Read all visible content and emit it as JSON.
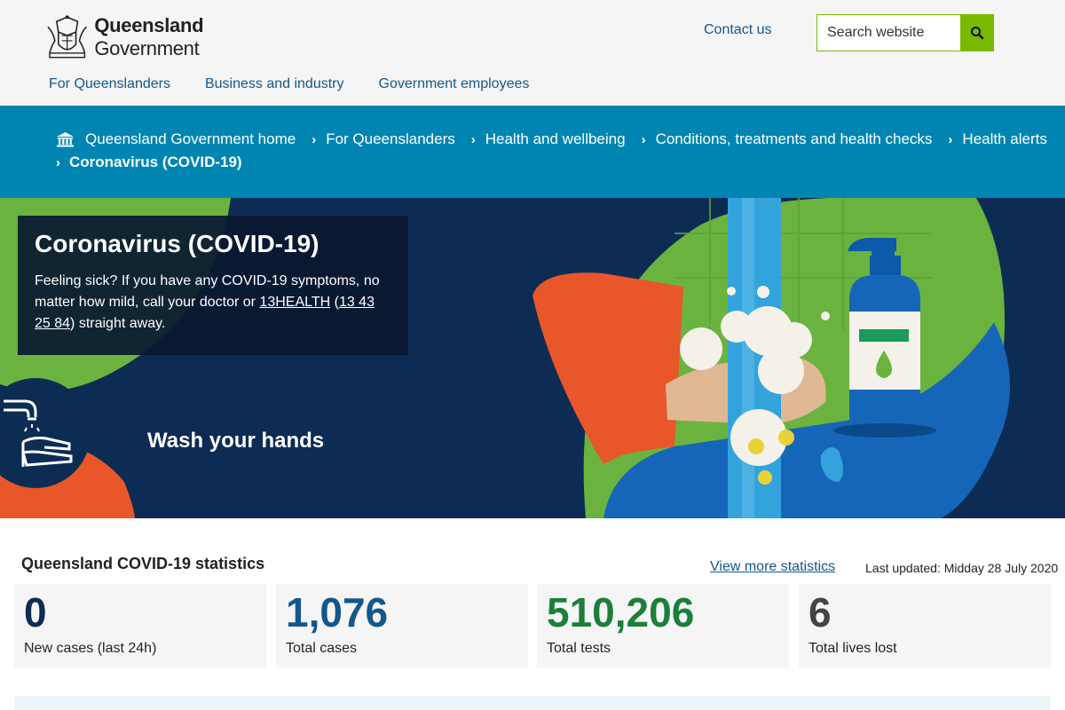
{
  "header": {
    "logo_bold": "Queensland",
    "logo_light": "Government",
    "contact_label": "Contact us",
    "search_placeholder": "Search website",
    "nav": [
      {
        "label": "For Queenslanders"
      },
      {
        "label": "Business and industry"
      },
      {
        "label": "Government employees"
      }
    ]
  },
  "breadcrumb": {
    "items": [
      {
        "label": "Queensland Government home"
      },
      {
        "label": "For Queenslanders"
      },
      {
        "label": "Health and wellbeing"
      },
      {
        "label": "Conditions, treatments and health checks"
      },
      {
        "label": "Health alerts"
      }
    ],
    "current": "Coronavirus (COVID-19)"
  },
  "hero": {
    "title": "Coronavirus (COVID-19)",
    "text_before": "Feeling sick? If you have any COVID-19 symptoms, no matter how mild, call your doctor or ",
    "link_health": "13HEALTH",
    "text_paren_open": " (",
    "link_phone": "13 43 25 84",
    "text_after": ") straight away.",
    "caption": "Wash your hands"
  },
  "stats": {
    "title": "Queensland COVID-19 statistics",
    "more_label": "View more statistics",
    "updated": "Last updated: Midday 28 July 2020",
    "cards": [
      {
        "value": "0",
        "label": "New cases (last 24h)",
        "color": "#0d2c54"
      },
      {
        "value": "1,076",
        "label": "Total cases",
        "color": "#13578b"
      },
      {
        "value": "510,206",
        "label": "Total tests",
        "color": "#1b7f3a"
      },
      {
        "value": "6",
        "label": "Total lives lost",
        "color": "#444444"
      }
    ]
  },
  "colors": {
    "header_bg": "#f5f5f5",
    "link": "#13578b",
    "breadcrumb_bg": "#0085b3",
    "banner_bg": "#0d2c54",
    "accent_green": "#78ba00",
    "orange": "#e8562a"
  },
  "icons": {
    "search": "search-icon",
    "home": "bank-building-icon",
    "chevron": "chevron-right-icon",
    "handwash": "handwash-icon",
    "crest": "coat-of-arms-icon"
  }
}
